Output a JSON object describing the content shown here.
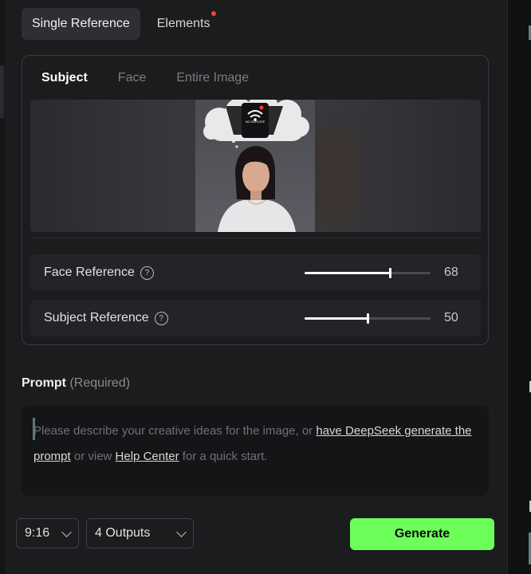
{
  "tabs": [
    {
      "label": "Single Reference",
      "active": true
    },
    {
      "label": "Elements",
      "active": false,
      "has_notification_dot": true
    }
  ],
  "reference_panel": {
    "sub_tabs": [
      {
        "label": "Subject",
        "active": true
      },
      {
        "label": "Face",
        "active": false
      },
      {
        "label": "Entire Image",
        "active": false
      }
    ],
    "sliders": [
      {
        "label": "Face Reference",
        "value": "68",
        "fraction": 0.68
      },
      {
        "label": "Subject Reference",
        "value": "50",
        "fraction": 0.5
      }
    ],
    "preview_sign_text": "NO SERVICE"
  },
  "prompt": {
    "label": "Prompt",
    "required_text": "(Required)",
    "placeholder_part1": "Please describe your creative ideas for the image, or ",
    "link_deepseek": "have DeepSeek generate the prompt",
    "placeholder_part2": " or view ",
    "link_help": "Help Center",
    "placeholder_part3": " for a quick start."
  },
  "controls": {
    "aspect_ratio": "9:16",
    "outputs": "4 Outputs",
    "generate_label": "Generate"
  },
  "colors": {
    "accent": "#6cff5a",
    "background": "#1b1c1e",
    "notification": "#ff3b3b"
  }
}
